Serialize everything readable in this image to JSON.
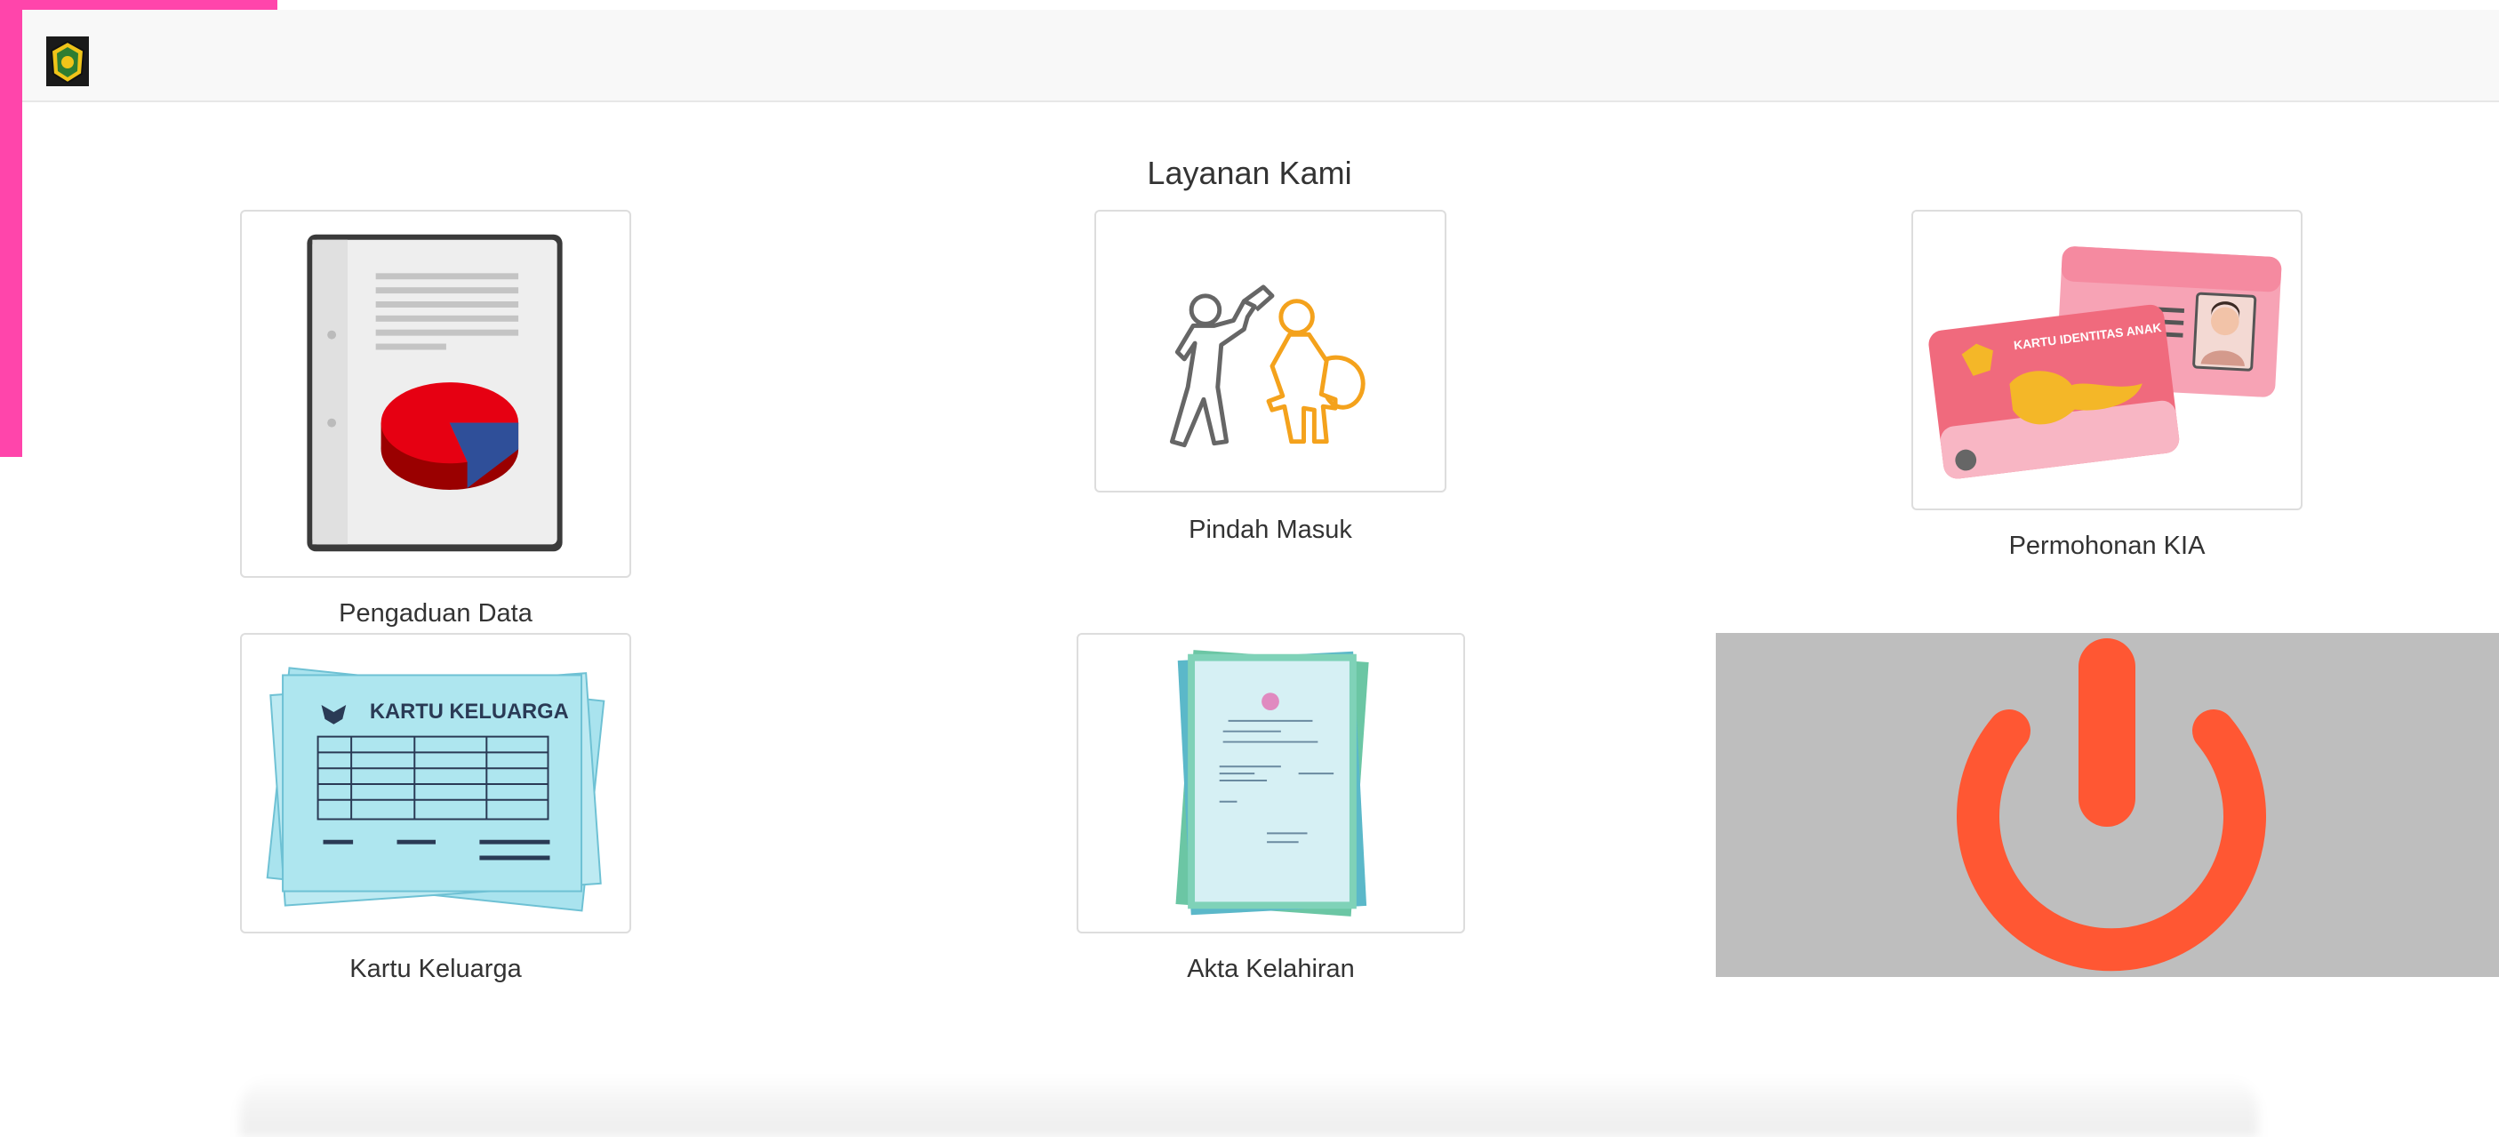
{
  "header": {
    "logo_icon": "garuda-emblem-icon"
  },
  "main": {
    "title": "Layanan Kami",
    "services": [
      {
        "label": "Pengaduan Data",
        "icon": "report-chart-icon"
      },
      {
        "label": "Pindah Masuk",
        "icon": "moving-people-icon"
      },
      {
        "label": "Permohonan KIA",
        "icon": "child-id-card-icon"
      },
      {
        "label": "Kartu Keluarga",
        "icon": "family-card-icon"
      },
      {
        "label": "Akta Kelahiran",
        "icon": "birth-certificate-icon"
      }
    ],
    "power_button": {
      "icon": "power-icon",
      "color": "#ff5733"
    }
  },
  "kia_card_text": "KARTU IDENTITAS ANAK",
  "kk_card_text": "KARTU KELUARGA"
}
